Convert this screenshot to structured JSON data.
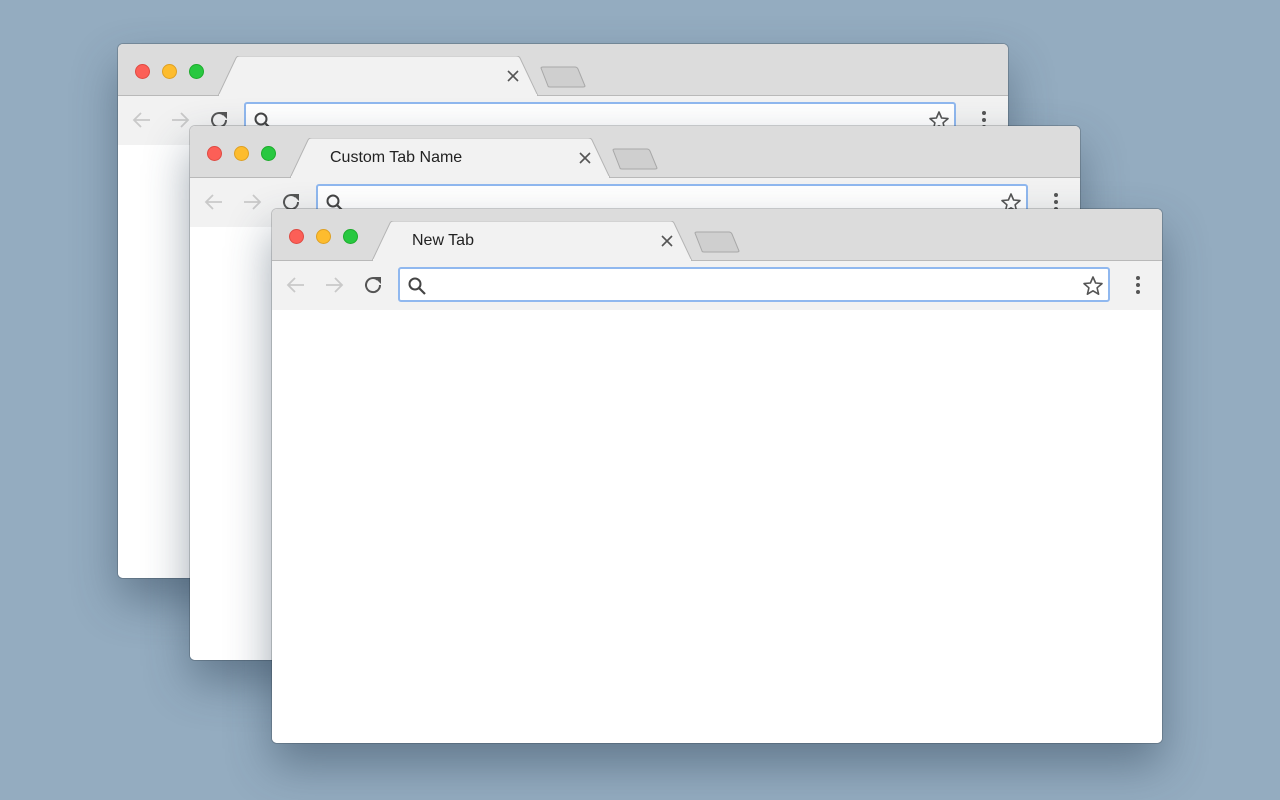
{
  "windows": {
    "back": {
      "tab_title": "",
      "omnibox_value": "",
      "controls": {
        "close": "close-traffic-light",
        "minimize": "minimize-traffic-light",
        "maximize": "maximize-traffic-light"
      }
    },
    "middle": {
      "tab_title": "Custom Tab Name",
      "omnibox_value": ""
    },
    "front": {
      "tab_title": "New Tab",
      "omnibox_value": ""
    }
  },
  "icons": {
    "back": "arrow-left-icon",
    "forward": "arrow-right-icon",
    "reload": "reload-icon",
    "search": "search-icon",
    "bookmark": "star-icon",
    "menu": "more-vertical-icon",
    "tab_close": "close-icon",
    "new_tab": "new-tab-icon"
  },
  "colors": {
    "desktop": "#94acc0",
    "close": "#fc5f57",
    "minimize": "#fdbc2e",
    "maximize": "#28c840",
    "omnibox_focus": "#90b8ef"
  }
}
